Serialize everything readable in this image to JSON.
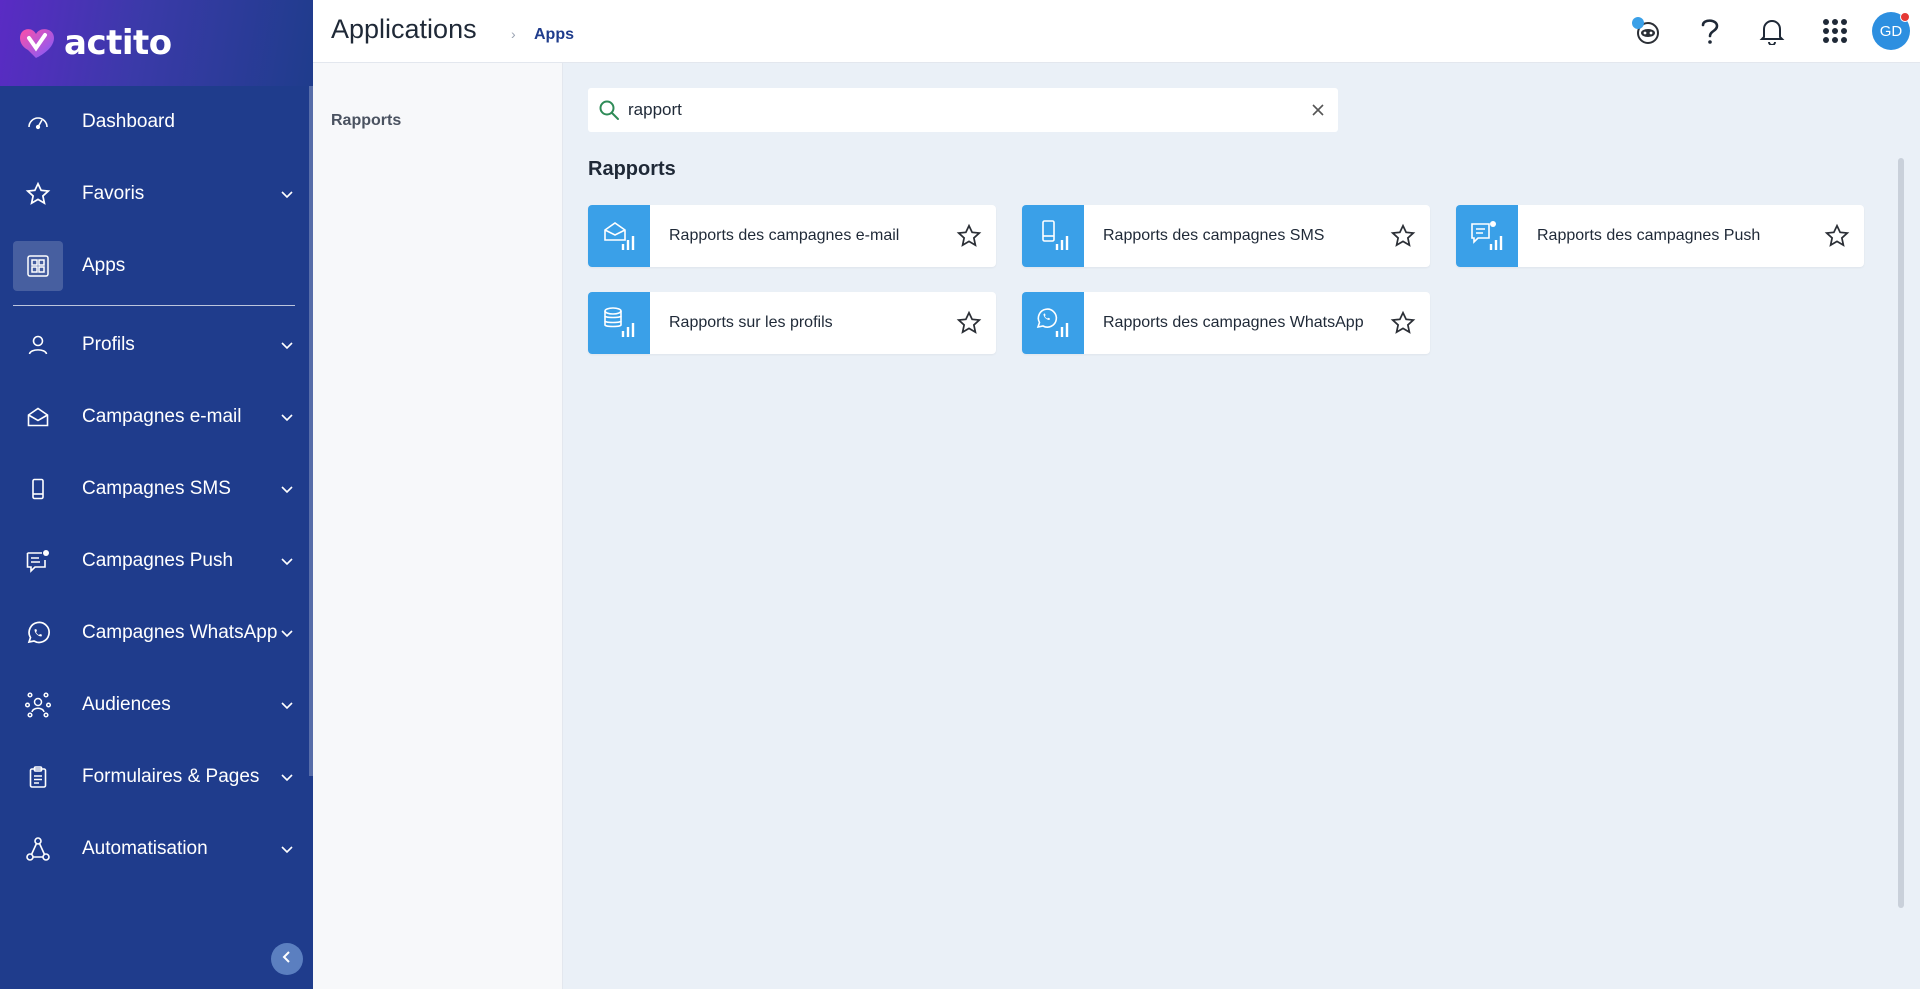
{
  "brand": {
    "name": "actito"
  },
  "sidebar": {
    "items": [
      {
        "label": "Dashboard",
        "icon": "gauge-icon",
        "chevron": false
      },
      {
        "label": "Favoris",
        "icon": "star-icon",
        "chevron": true
      },
      {
        "label": "Apps",
        "icon": "apps-grid-icon",
        "chevron": false,
        "active": true
      },
      {
        "label": "Profils",
        "icon": "user-icon",
        "chevron": true
      },
      {
        "label": "Campagnes e-mail",
        "icon": "envelope-icon",
        "chevron": true
      },
      {
        "label": "Campagnes SMS",
        "icon": "phone-icon",
        "chevron": true
      },
      {
        "label": "Campagnes Push",
        "icon": "push-message-icon",
        "chevron": true
      },
      {
        "label": "Campagnes WhatsApp",
        "icon": "whatsapp-icon",
        "chevron": true
      },
      {
        "label": "Audiences",
        "icon": "network-icon",
        "chevron": true
      },
      {
        "label": "Formulaires & Pages",
        "icon": "clipboard-icon",
        "chevron": true
      },
      {
        "label": "Automatisation",
        "icon": "flow-icon",
        "chevron": true
      }
    ]
  },
  "header": {
    "title": "Applications",
    "breadcrumb": "Apps",
    "avatar_initials": "GD",
    "colors": {
      "accent": "#1f3c8c",
      "avatar": "#2d8fe0",
      "notification": "#e53935"
    }
  },
  "subpanel": {
    "item": "Rapports"
  },
  "search": {
    "value": "rapport"
  },
  "results": {
    "section_title": "Rapports",
    "cards": [
      {
        "label": "Rapports des campagnes e-mail",
        "icon": "email-report-icon"
      },
      {
        "label": "Rapports des campagnes SMS",
        "icon": "sms-report-icon"
      },
      {
        "label": "Rapports des campagnes Push",
        "icon": "push-report-icon"
      },
      {
        "label": "Rapports sur les profils",
        "icon": "profile-report-icon"
      },
      {
        "label": "Rapports des campagnes WhatsApp",
        "icon": "whatsapp-report-icon"
      }
    ],
    "card_icon_color": "#3aa0e8"
  }
}
